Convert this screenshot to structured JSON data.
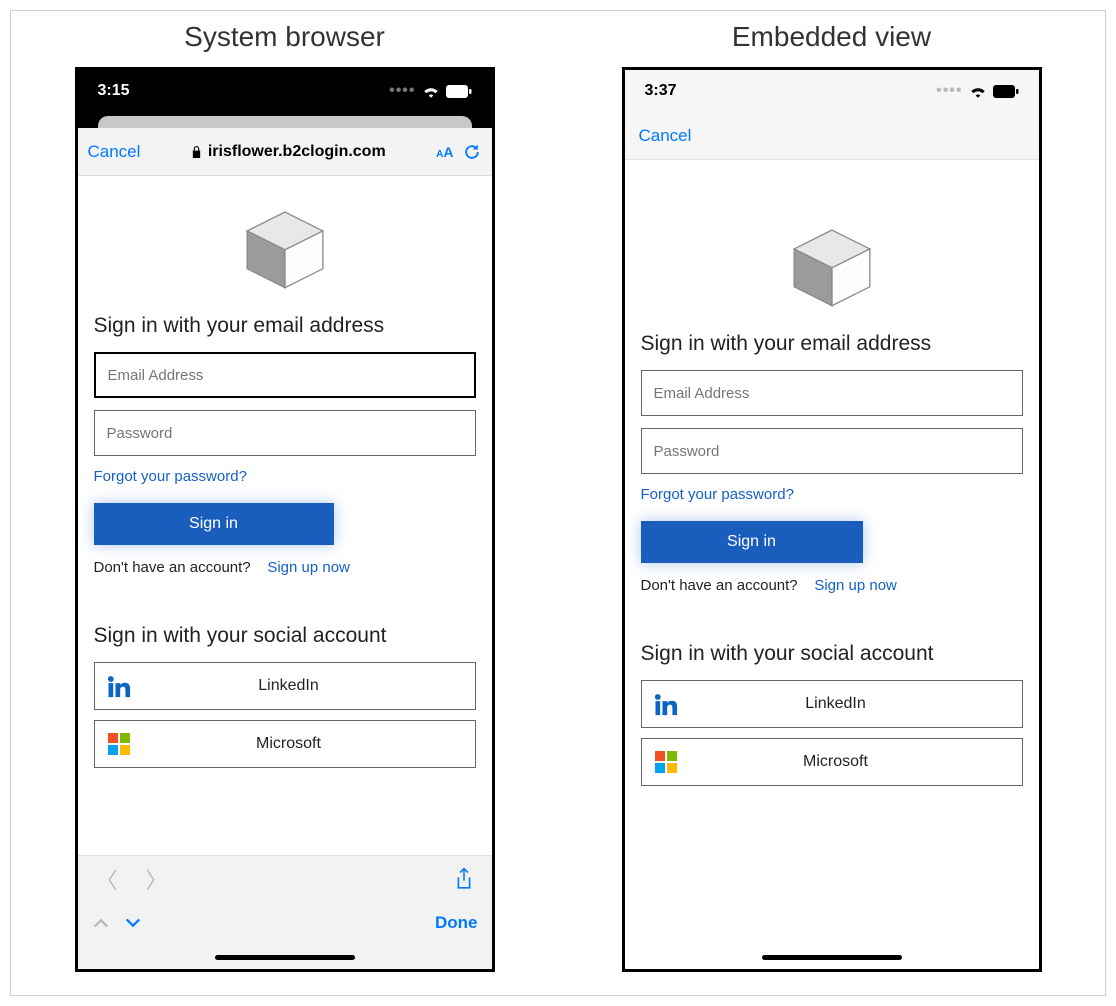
{
  "titles": {
    "left": "System browser",
    "right": "Embedded view"
  },
  "status": {
    "left_time": "3:15",
    "right_time": "3:37"
  },
  "browser": {
    "cancel": "Cancel",
    "domain": "irisflower.b2clogin.com",
    "aa_small": "A",
    "aa_big": "A",
    "done": "Done"
  },
  "embedded": {
    "cancel": "Cancel"
  },
  "form": {
    "heading_email": "Sign in with your email address",
    "email_placeholder": "Email Address",
    "password_placeholder": "Password",
    "forgot": "Forgot your password?",
    "signin": "Sign in",
    "noaccount": "Don't have an account?",
    "signup": "Sign up now",
    "heading_social": "Sign in with your social account",
    "linkedin": "LinkedIn",
    "microsoft": "Microsoft"
  }
}
